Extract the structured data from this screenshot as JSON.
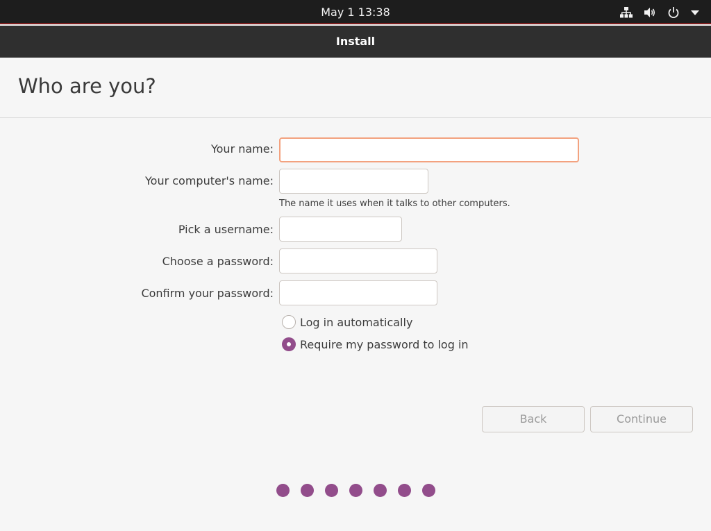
{
  "topbar": {
    "clock": "May 1  13:38",
    "icons": [
      "network-icon",
      "volume-icon",
      "power-icon",
      "menu-arrow-icon"
    ]
  },
  "window": {
    "title": "Install"
  },
  "page": {
    "heading": "Who are you?",
    "fields": {
      "name": {
        "label": "Your name:",
        "value": "",
        "placeholder": ""
      },
      "computer_name": {
        "label": "Your computer's name:",
        "value": "",
        "placeholder": ""
      },
      "computer_name_hint": "The name it uses when it talks to other computers.",
      "username": {
        "label": "Pick a username:",
        "value": "",
        "placeholder": ""
      },
      "password": {
        "label": "Choose a password:",
        "value": "",
        "placeholder": ""
      },
      "confirm_password": {
        "label": "Confirm your password:",
        "value": "",
        "placeholder": ""
      }
    },
    "login_options": {
      "auto_login": {
        "label": "Log in automatically",
        "selected": false
      },
      "require_password": {
        "label": "Require my password to log in",
        "selected": true
      }
    },
    "buttons": {
      "back": "Back",
      "continue": "Continue"
    },
    "progress": {
      "total_steps": 7,
      "dot_color": "#924d8b"
    }
  },
  "colors": {
    "accent": "#924d8b",
    "focus_border": "#f3a27f",
    "topbar_bg": "#1d1d1d",
    "titlebar_bg": "#2f2f2f"
  }
}
